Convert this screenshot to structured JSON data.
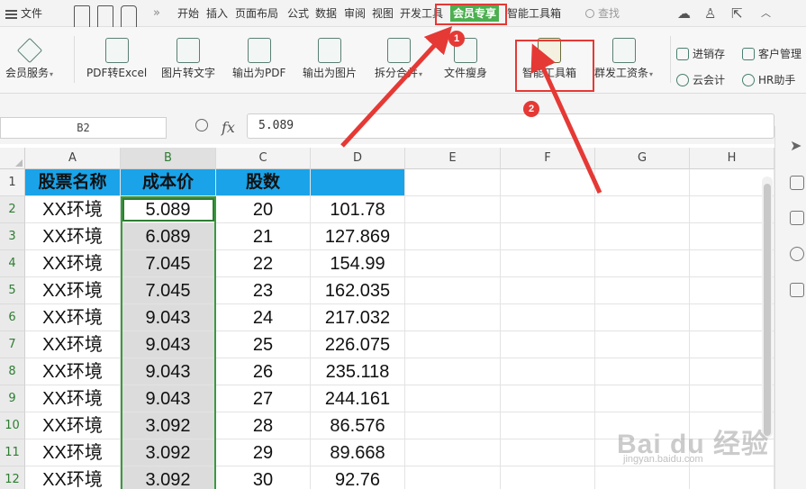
{
  "colors": {
    "accent_green": "#4caf50",
    "header_blue": "#1aa3e8",
    "selection_green": "#2e7d32",
    "annotation_red": "#e53935"
  },
  "menubar": {
    "file_label": "文件",
    "quick_access_icons": [
      "save-icon",
      "export-icon",
      "print-icon"
    ],
    "overflow_label": "»",
    "tabs": [
      "开始",
      "插入",
      "页面布局",
      "公式",
      "数据",
      "审阅",
      "视图",
      "开发工具",
      "会员专享",
      "智能工具箱"
    ],
    "active_tab": "会员专享",
    "search_label": "查找",
    "right_icons": [
      "cloud-icon",
      "user-add-icon",
      "share-icon",
      "collapse-icon"
    ]
  },
  "ribbon": {
    "member_service": "会员服务",
    "pdf_to_excel": "PDF转Excel",
    "image_to_text": "图片转文字",
    "export_pdf": "输出为PDF",
    "export_image": "输出为图片",
    "split_merge": "拆分合并",
    "file_slim": "文件瘦身",
    "smart_toolbox": "智能工具箱",
    "mass_payroll": "群发工资条",
    "inventory": "进销存",
    "customer_mgmt": "客户管理",
    "cloud_accounting": "云会计",
    "hr_assistant": "HR助手"
  },
  "formula_bar": {
    "name_box": "B2",
    "fx_label": "fx",
    "formula_value": "5.089"
  },
  "sheet": {
    "columns": [
      "A",
      "B",
      "C",
      "D",
      "E",
      "F",
      "G",
      "H"
    ],
    "headers": [
      "股票名称",
      "成本价",
      "股数"
    ],
    "rows": [
      {
        "num": "1"
      },
      {
        "num": "2",
        "a": "XX环境",
        "b": "5.089",
        "c": "20",
        "d": "101.78"
      },
      {
        "num": "3",
        "a": "XX环境",
        "b": "6.089",
        "c": "21",
        "d": "127.869"
      },
      {
        "num": "4",
        "a": "XX环境",
        "b": "7.045",
        "c": "22",
        "d": "154.99"
      },
      {
        "num": "5",
        "a": "XX环境",
        "b": "7.045",
        "c": "23",
        "d": "162.035"
      },
      {
        "num": "6",
        "a": "XX环境",
        "b": "9.043",
        "c": "24",
        "d": "217.032"
      },
      {
        "num": "7",
        "a": "XX环境",
        "b": "9.043",
        "c": "25",
        "d": "226.075"
      },
      {
        "num": "8",
        "a": "XX环境",
        "b": "9.043",
        "c": "26",
        "d": "235.118"
      },
      {
        "num": "9",
        "a": "XX环境",
        "b": "9.043",
        "c": "27",
        "d": "244.161"
      },
      {
        "num": "10",
        "a": "XX环境",
        "b": "3.092",
        "c": "28",
        "d": "86.576"
      },
      {
        "num": "11",
        "a": "XX环境",
        "b": "3.092",
        "c": "29",
        "d": "89.668"
      },
      {
        "num": "12",
        "a": "XX环境",
        "b": "3.092",
        "c": "30",
        "d": "92.76"
      }
    ]
  },
  "annotations": {
    "step1": "1",
    "step2": "2"
  },
  "watermark": {
    "logo": "Bai du 经验",
    "url": "jingyan.baidu.com"
  }
}
